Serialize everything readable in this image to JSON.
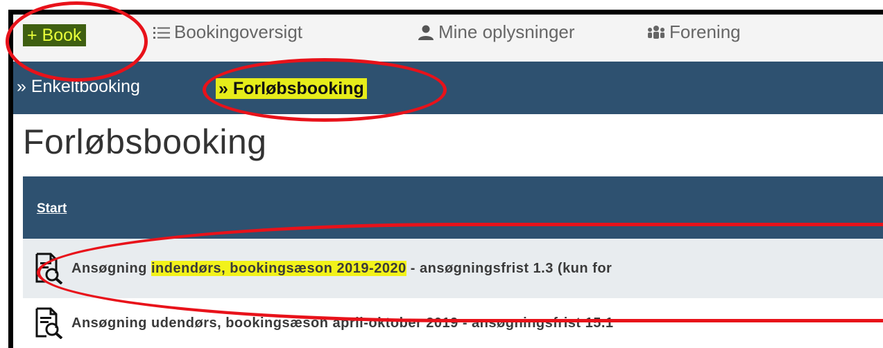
{
  "topnav": {
    "items": [
      {
        "label": "+ Book",
        "icon": "plus-icon"
      },
      {
        "label": "Bookingoversigt",
        "icon": "list-icon"
      },
      {
        "label": "Mine oplysninger",
        "icon": "user-icon"
      },
      {
        "label": "Forening",
        "icon": "group-icon"
      }
    ]
  },
  "subnav": {
    "enkelt": "» Enkeltbooking",
    "forlob": "» Forløbsbooking"
  },
  "page": {
    "title": "Forløbsbooking"
  },
  "table": {
    "header": "Start",
    "rows": [
      {
        "pre": "Ansøgning ",
        "highlight": "indendørs, bookingsæson 2019-2020",
        "post": " - ansøgningsfrist 1.3 (kun for"
      },
      {
        "text": "Ansøgning udendørs, bookingsæson april-oktober 2019 - ansøgningsfrist 15.1"
      }
    ]
  },
  "colors": {
    "nav_dark": "#2e5170",
    "highlight": "#f2f21a",
    "annotation_red": "#e8121a"
  }
}
